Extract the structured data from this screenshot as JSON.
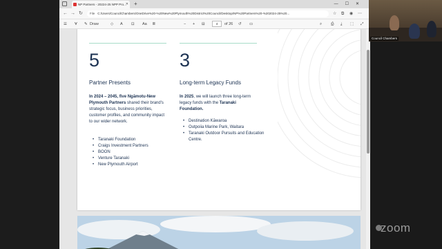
{
  "browser": {
    "tab_title": "NP Partners - 20224-25 NPP Pro...",
    "url_prefix": "File",
    "url": "C:/Users/CouncilChambers/OneDrive%20-%20New%20Plymouth%20District%20Council/Desktop/NP%20Partners%20-%202024-25%20...",
    "page_number": "4",
    "page_total": "of 26",
    "toolbar_draw": "Draw",
    "toolbar_read_aloud": "Aa"
  },
  "document": {
    "col1": {
      "number": "5",
      "heading": "Partner Presents",
      "para_bold1": "In 2024 – 2045, five Ngāmotu-New Plymouth Partners",
      "para_rest": " shared their brand's strategic focus, business priorities, customer profiles, and community impact to our wider network.",
      "items": [
        "Taranaki Foundation",
        "Craigs Investment Partners",
        "BOON",
        "Venture Taranaki",
        "New Plymouth Airport"
      ]
    },
    "col2": {
      "number": "3",
      "heading": "Long-term Legacy Funds",
      "para_bold1": "In 2025",
      "para_mid": ", we will launch three long-term legacy funds with the ",
      "para_bold2": "Taranaki Foundation.",
      "items": [
        "Destination Kāwaroa",
        "Outpoiia Marine Park, Waitara",
        "Taranaki Outdoor Pursuits and Education Centre."
      ]
    }
  },
  "zoom": {
    "participant_name": "Council Chambers",
    "brand": "zoom"
  },
  "colors": {
    "text_navy": "#1d3353",
    "accent_mint": "#a8dcc9"
  }
}
